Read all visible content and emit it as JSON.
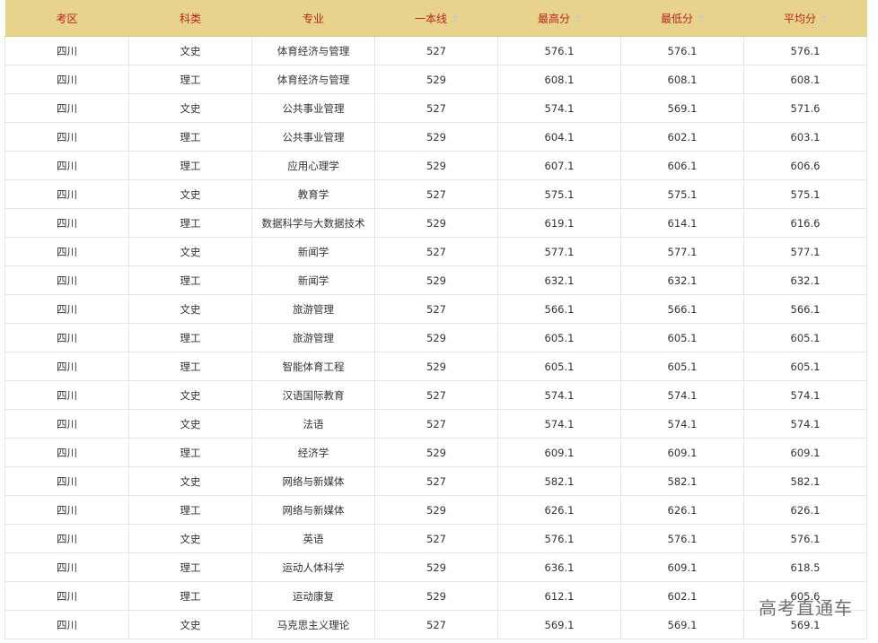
{
  "table": {
    "headers": [
      {
        "label": "考区",
        "sortable": false
      },
      {
        "label": "科类",
        "sortable": false
      },
      {
        "label": "专业",
        "sortable": false
      },
      {
        "label": "一本线",
        "sortable": true
      },
      {
        "label": "最高分",
        "sortable": true
      },
      {
        "label": "最低分",
        "sortable": true
      },
      {
        "label": "平均分",
        "sortable": true
      }
    ],
    "rows": [
      [
        "四川",
        "文史",
        "体育经济与管理",
        "527",
        "576.1",
        "576.1",
        "576.1"
      ],
      [
        "四川",
        "理工",
        "体育经济与管理",
        "529",
        "608.1",
        "608.1",
        "608.1"
      ],
      [
        "四川",
        "文史",
        "公共事业管理",
        "527",
        "574.1",
        "569.1",
        "571.6"
      ],
      [
        "四川",
        "理工",
        "公共事业管理",
        "529",
        "604.1",
        "602.1",
        "603.1"
      ],
      [
        "四川",
        "理工",
        "应用心理学",
        "529",
        "607.1",
        "606.1",
        "606.6"
      ],
      [
        "四川",
        "文史",
        "教育学",
        "527",
        "575.1",
        "575.1",
        "575.1"
      ],
      [
        "四川",
        "理工",
        "数据科学与大数据技术",
        "529",
        "619.1",
        "614.1",
        "616.6"
      ],
      [
        "四川",
        "文史",
        "新闻学",
        "527",
        "577.1",
        "577.1",
        "577.1"
      ],
      [
        "四川",
        "理工",
        "新闻学",
        "529",
        "632.1",
        "632.1",
        "632.1"
      ],
      [
        "四川",
        "文史",
        "旅游管理",
        "527",
        "566.1",
        "566.1",
        "566.1"
      ],
      [
        "四川",
        "理工",
        "旅游管理",
        "529",
        "605.1",
        "605.1",
        "605.1"
      ],
      [
        "四川",
        "理工",
        "智能体育工程",
        "529",
        "605.1",
        "605.1",
        "605.1"
      ],
      [
        "四川",
        "文史",
        "汉语国际教育",
        "527",
        "574.1",
        "574.1",
        "574.1"
      ],
      [
        "四川",
        "文史",
        "法语",
        "527",
        "574.1",
        "574.1",
        "574.1"
      ],
      [
        "四川",
        "理工",
        "经济学",
        "529",
        "609.1",
        "609.1",
        "609.1"
      ],
      [
        "四川",
        "文史",
        "网络与新媒体",
        "527",
        "582.1",
        "582.1",
        "582.1"
      ],
      [
        "四川",
        "理工",
        "网络与新媒体",
        "529",
        "626.1",
        "626.1",
        "626.1"
      ],
      [
        "四川",
        "文史",
        "英语",
        "527",
        "576.1",
        "576.1",
        "576.1"
      ],
      [
        "四川",
        "理工",
        "运动人体科学",
        "529",
        "636.1",
        "609.1",
        "618.5"
      ],
      [
        "四川",
        "理工",
        "运动康复",
        "529",
        "612.1",
        "602.1",
        "605.6"
      ],
      [
        "四川",
        "文史",
        "马克思主义理论",
        "527",
        "569.1",
        "569.1",
        "569.1"
      ]
    ]
  },
  "watermark": "高考直通车",
  "colors": {
    "header_bg": "#e8d38c",
    "header_text": "#b8241c"
  }
}
